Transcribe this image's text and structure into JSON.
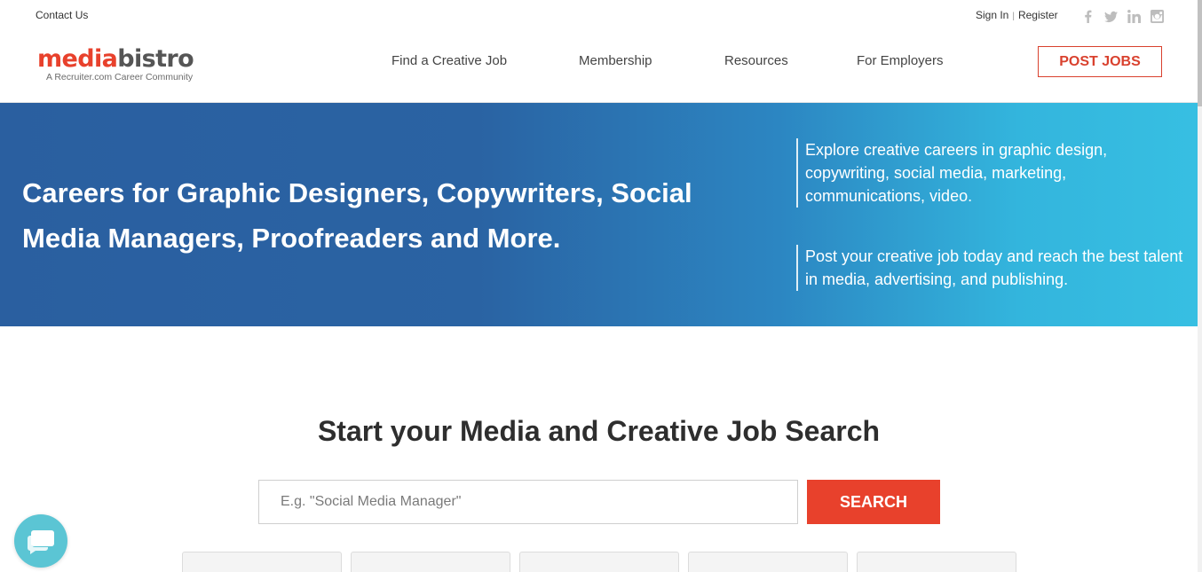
{
  "topbar": {
    "contact_label": "Contact Us",
    "sign_in_label": "Sign In",
    "separator": "|",
    "register_label": "Register",
    "social": [
      "facebook-icon",
      "twitter-icon",
      "linkedin-icon",
      "instagram-icon"
    ]
  },
  "header": {
    "logo_part1": "media",
    "logo_part2": "bistro",
    "tagline": "A Recruiter.com Career Community",
    "nav": [
      {
        "label": "Find a Creative Job"
      },
      {
        "label": "Membership"
      },
      {
        "label": "Resources"
      },
      {
        "label": "For Employers"
      }
    ],
    "post_jobs_label": "POST JOBS"
  },
  "hero": {
    "title": "Careers for Graphic Designers, Copywriters, Social Media Managers, Proofreaders and More.",
    "note1": "Explore creative careers in graphic design, copywriting, social media, marketing, communications, video.",
    "note2": "Post your creative job today and reach the best talent in media, advertising, and publishing."
  },
  "search": {
    "title": "Start your Media and Creative Job Search",
    "placeholder": "E.g. \"Social Media Manager\"",
    "value": "",
    "button_label": "SEARCH"
  },
  "colors": {
    "accent": "#e8412c",
    "hero_start": "#2a5fa0",
    "hero_end": "#37bfe2",
    "chat": "#5bc5d4"
  }
}
